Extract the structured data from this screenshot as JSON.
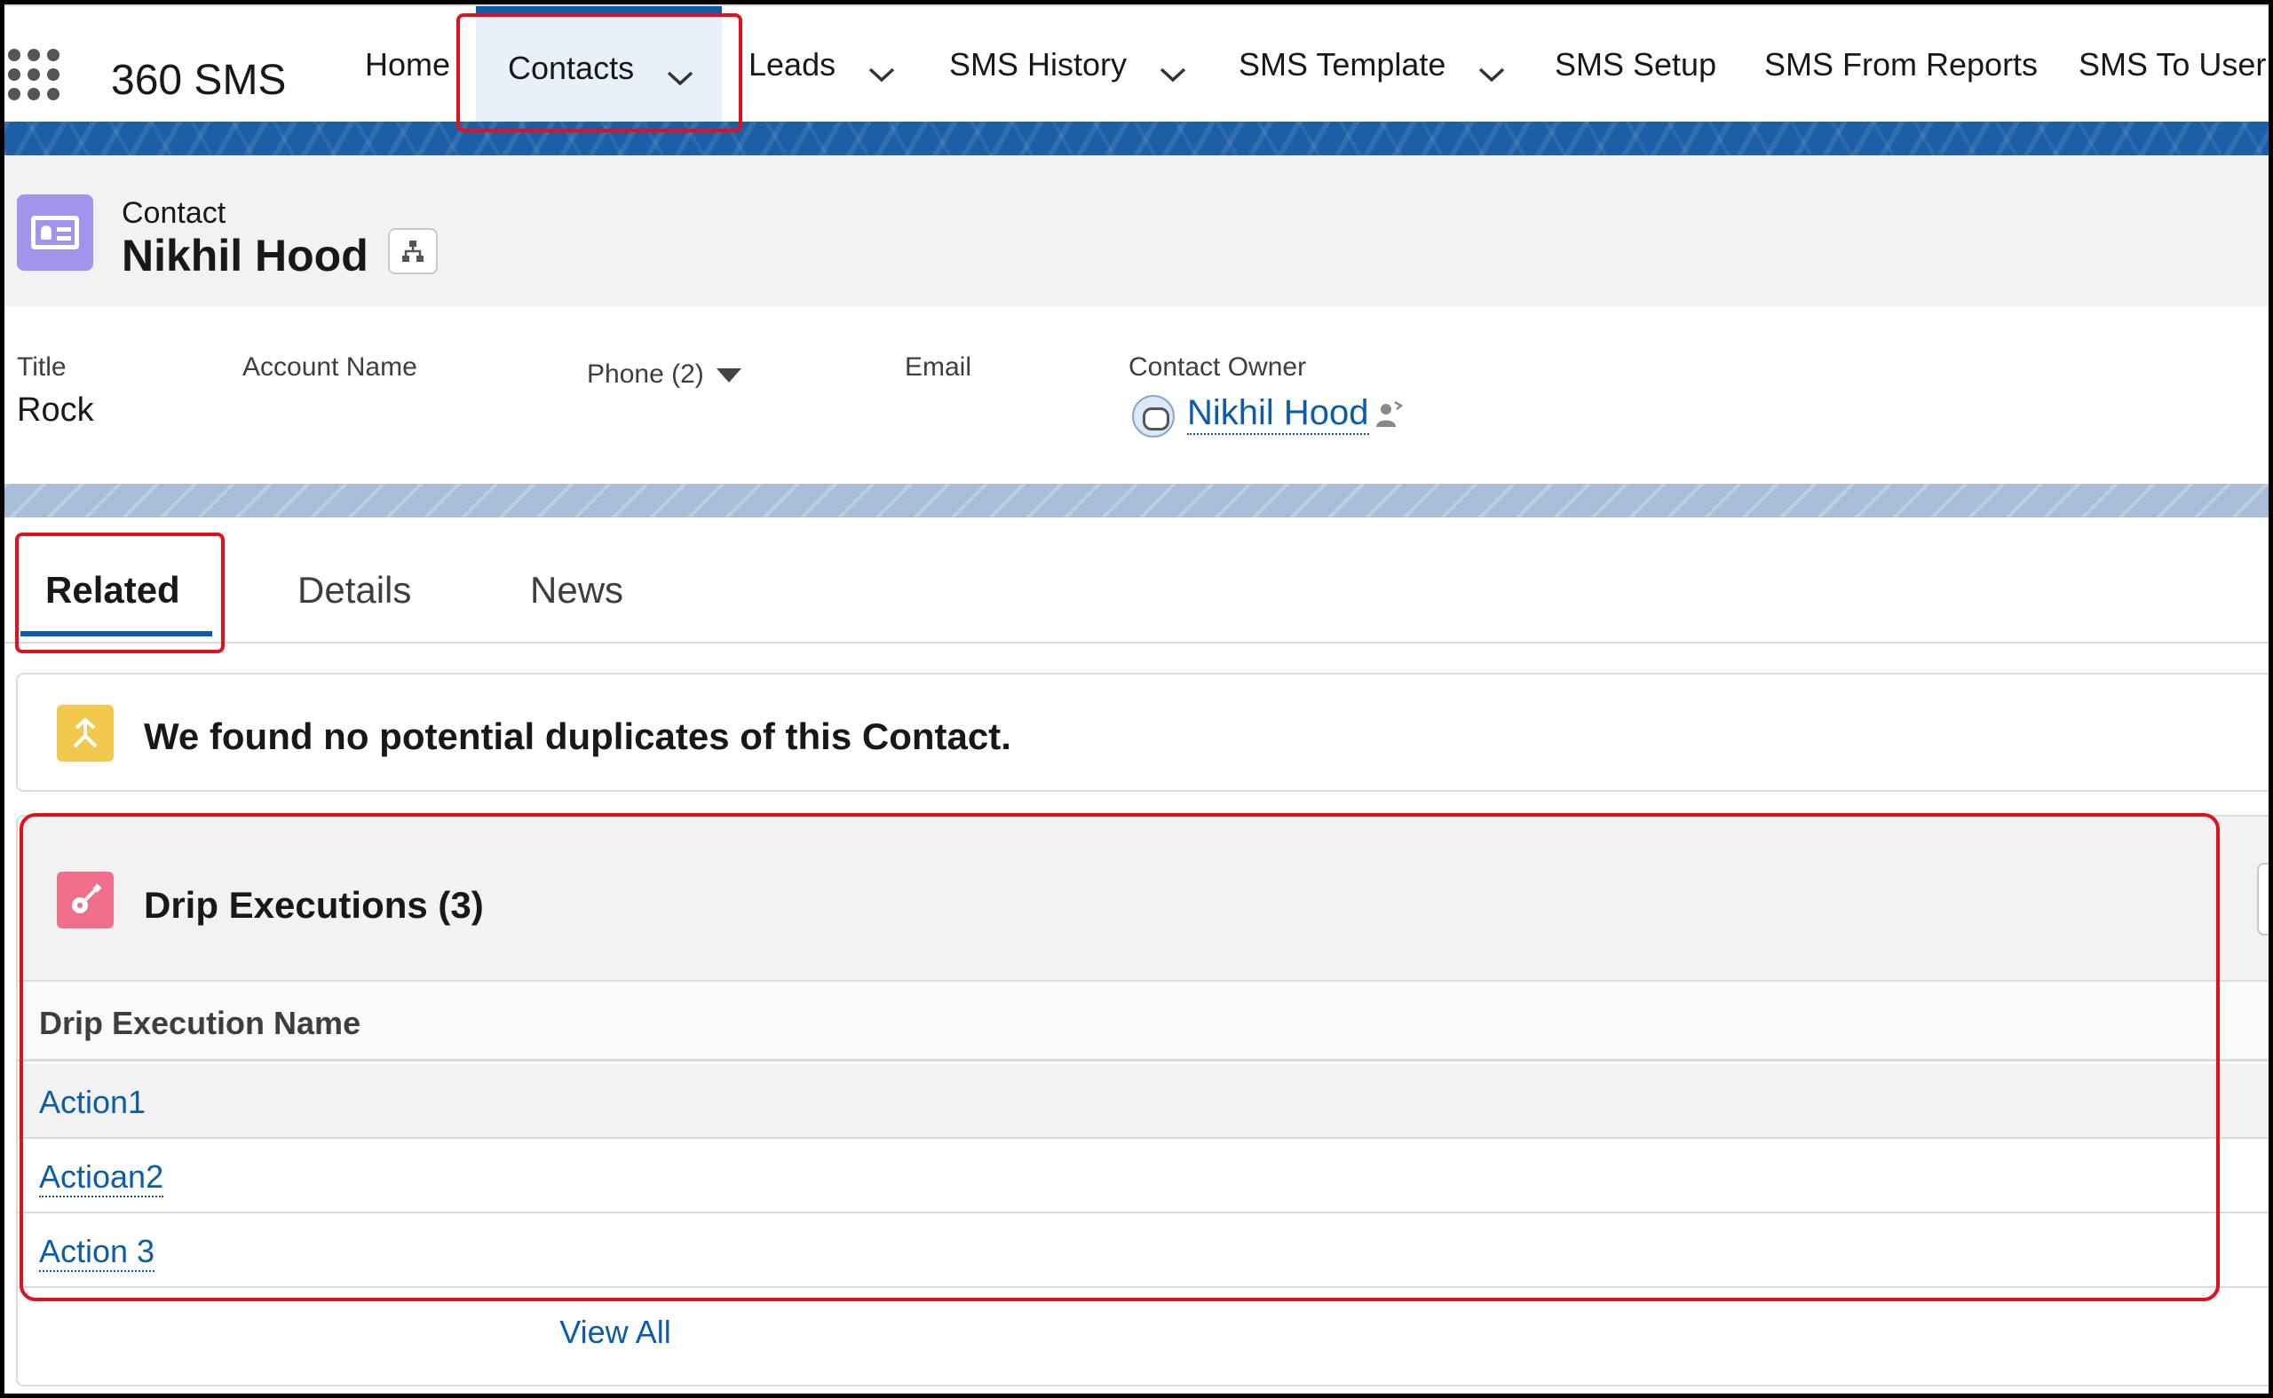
{
  "app": {
    "name": "360 SMS"
  },
  "nav": {
    "items": [
      {
        "label": "Home"
      },
      {
        "label": "Contacts"
      },
      {
        "label": "Leads"
      },
      {
        "label": "SMS History"
      },
      {
        "label": "SMS Template"
      },
      {
        "label": "SMS Setup"
      },
      {
        "label": "SMS From Reports"
      },
      {
        "label": "SMS To User"
      }
    ]
  },
  "record": {
    "object_label": "Contact",
    "name": "Nikhil Hood"
  },
  "highlights": {
    "title_label": "Title",
    "title_value": "Rock",
    "account_label": "Account Name",
    "phone_label": "Phone (2)",
    "email_label": "Email",
    "owner_label": "Contact Owner",
    "owner_value": "Nikhil Hood"
  },
  "tabs": [
    {
      "label": "Related"
    },
    {
      "label": "Details"
    },
    {
      "label": "News"
    }
  ],
  "duplicates": {
    "message": "We found no potential duplicates of this Contact."
  },
  "drip": {
    "title": "Drip Executions (3)",
    "column_header": "Drip Execution Name",
    "rows": [
      "Action1",
      "Actioan2",
      "Action 3"
    ],
    "view_all": "View All"
  },
  "colors": {
    "brand_band": "#1b5fa6",
    "link": "#0b5cab",
    "annotation": "#e3101c",
    "contact_icon": "#a094ed",
    "drip_icon": "#ef6e8c",
    "duplicate_icon": "#f2c94c"
  },
  "icons": [
    "app-launcher-icon",
    "chevron-down-icon",
    "contact-card-icon",
    "hierarchy-icon",
    "caret-down-icon",
    "owner-avatar-icon",
    "change-owner-icon",
    "duplicate-icon",
    "guitar-icon"
  ]
}
